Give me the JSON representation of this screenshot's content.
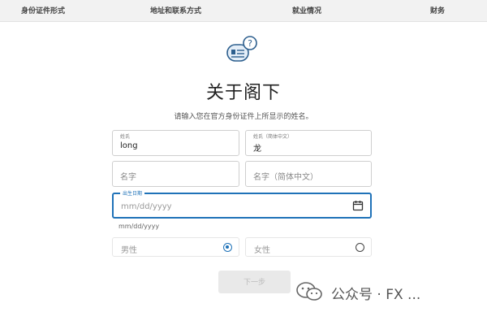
{
  "nav": {
    "steps": [
      "身份证件形式",
      "地址和联系方式",
      "就业情况",
      "财务"
    ]
  },
  "hero": {
    "icon": "id-card-question-icon"
  },
  "page": {
    "title": "关于阁下",
    "subtitle": "请输入您在官方身份证件上所显示的姓名。"
  },
  "form": {
    "surname": {
      "label": "姓氏",
      "value": "long"
    },
    "surname_cn": {
      "label": "姓氏（简体中文）",
      "value": "龙"
    },
    "given_name": {
      "placeholder": "名字"
    },
    "given_name_cn": {
      "placeholder": "名字（简体中文）"
    },
    "dob": {
      "label": "出生日期",
      "placeholder": "mm/dd/yyyy",
      "hint": "mm/dd/yyyy"
    },
    "gender_male": {
      "label": "男性",
      "selected": true
    },
    "gender_female": {
      "label": "女性",
      "selected": false
    },
    "next_label": "下一步"
  },
  "watermark": {
    "text": "公众号 · FX ..."
  },
  "colors": {
    "accent": "#1f72b8",
    "nav_bg": "#f2f2f2"
  }
}
